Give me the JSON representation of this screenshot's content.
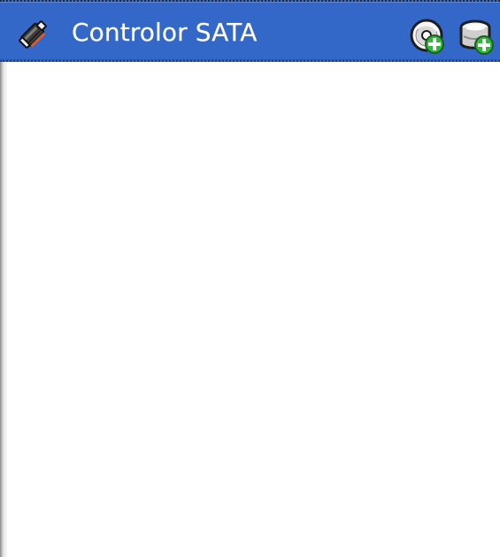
{
  "header": {
    "title": "Controlor SATA",
    "icons": {
      "controller": "storage-controller-icon",
      "add_optical": "add-optical-drive-icon",
      "add_hard_disk": "add-hard-disk-icon"
    }
  },
  "colors": {
    "header_background": "#3368c8",
    "header_text": "#ffffff",
    "content_background": "#ffffff",
    "add_badge": "#33b83c"
  },
  "content": {
    "items": []
  }
}
